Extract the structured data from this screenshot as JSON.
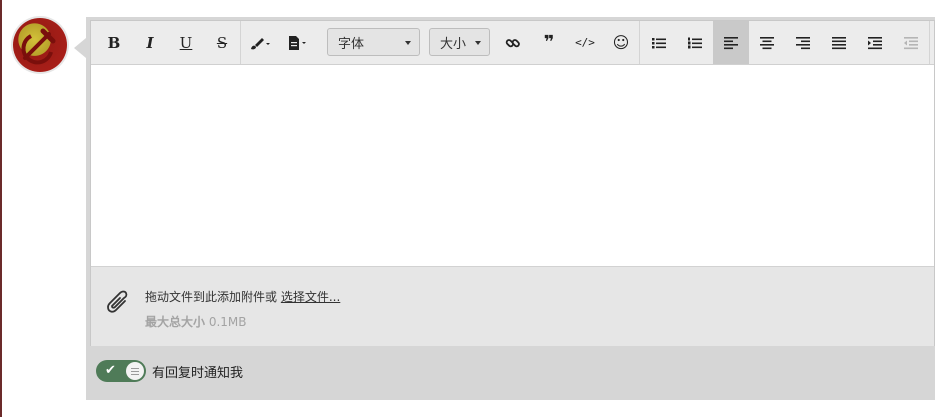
{
  "toolbar": {
    "bold": "B",
    "italic": "I",
    "underline": "U",
    "strike": "S",
    "font_label": "字体",
    "size_label": "大小",
    "quote": "❞",
    "code": "</>",
    "emoji": "☺"
  },
  "attachment": {
    "drop_text": "拖动文件到此添加附件或",
    "choose_link": "选择文件...",
    "max_label": "最大总大小",
    "max_value": "0.1MB"
  },
  "notify": {
    "enabled": true,
    "label": "有回复时通知我"
  }
}
